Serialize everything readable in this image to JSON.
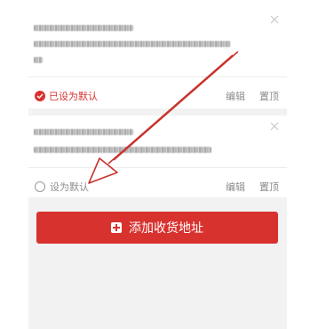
{
  "addresses": [
    {
      "status_label": "已设为默认",
      "is_default": true,
      "edit_label": "编辑",
      "pin_label": "置顶"
    },
    {
      "status_label": "设为默认",
      "is_default": false,
      "edit_label": "编辑",
      "pin_label": "置顶"
    }
  ],
  "add_button": {
    "label": "添加收货地址"
  },
  "colors": {
    "accent": "#d8322f",
    "background": "#f2f2f2",
    "card": "#ffffff",
    "muted_text": "#8c8c8c"
  },
  "icons": {
    "close": "close-icon",
    "default_check": "check-circle-icon",
    "set_default_radio": "radio-circle-icon",
    "add": "plus-square-icon"
  }
}
